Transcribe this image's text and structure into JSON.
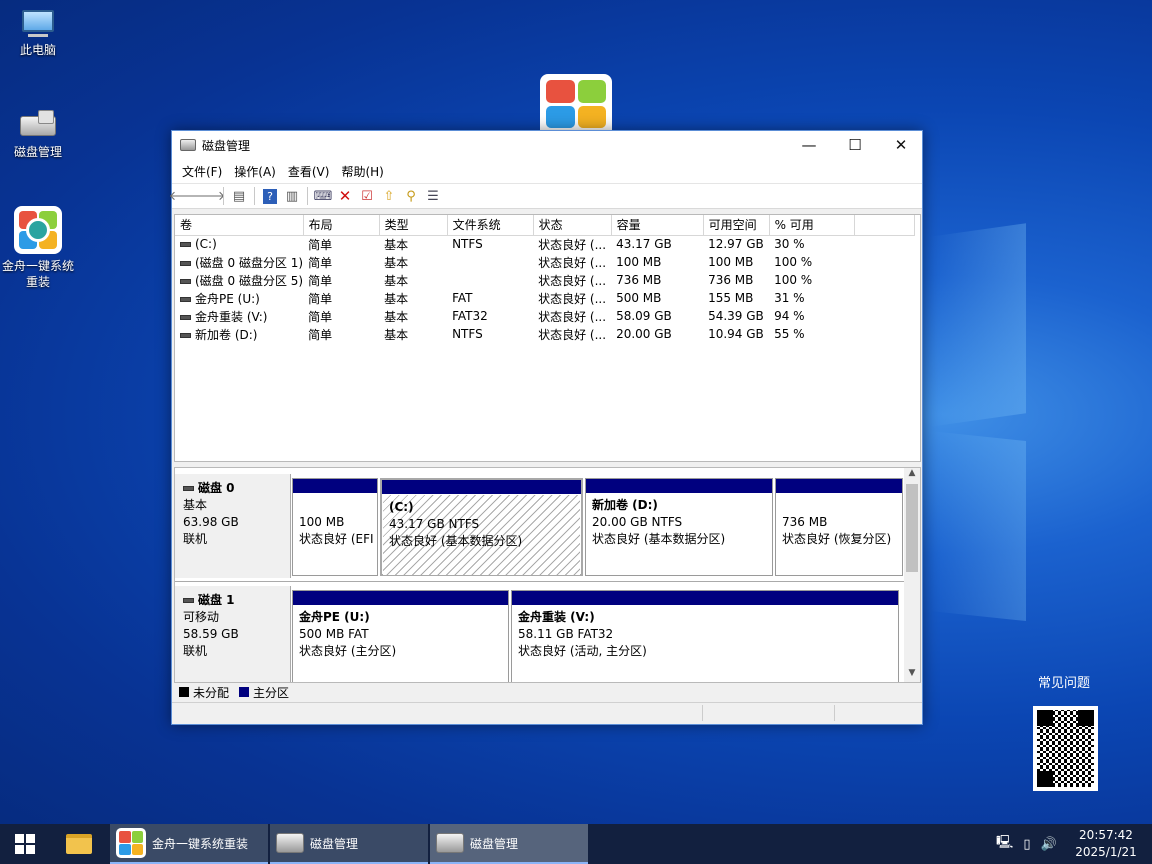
{
  "desktop": {
    "icons": [
      {
        "label": "此电脑",
        "icon": "computer-icon"
      },
      {
        "label": "磁盘管理",
        "icon": "disk-management-icon"
      },
      {
        "label": "金舟一键系统重装",
        "icon": "jinzhou-reinstall-icon"
      }
    ],
    "faq_label": "常见问题"
  },
  "window": {
    "title": "磁盘管理",
    "controls": {
      "minimize": "—",
      "maximize": "☐",
      "close": "✕"
    },
    "menu": [
      "文件(F)",
      "操作(A)",
      "查看(V)",
      "帮助(H)"
    ],
    "columns": [
      "卷",
      "布局",
      "类型",
      "文件系统",
      "状态",
      "容量",
      "可用空间",
      "% 可用"
    ],
    "volumes": [
      {
        "name": "(C:)",
        "layout": "简单",
        "type": "基本",
        "fs": "NTFS",
        "status": "状态良好 (...",
        "capacity": "43.17 GB",
        "free": "12.97 GB",
        "pct": "30 %"
      },
      {
        "name": "(磁盘 0 磁盘分区 1)",
        "layout": "简单",
        "type": "基本",
        "fs": "",
        "status": "状态良好 (...",
        "capacity": "100 MB",
        "free": "100 MB",
        "pct": "100 %"
      },
      {
        "name": "(磁盘 0 磁盘分区 5)",
        "layout": "简单",
        "type": "基本",
        "fs": "",
        "status": "状态良好 (...",
        "capacity": "736 MB",
        "free": "736 MB",
        "pct": "100 %"
      },
      {
        "name": "金舟PE (U:)",
        "layout": "简单",
        "type": "基本",
        "fs": "FAT",
        "status": "状态良好 (...",
        "capacity": "500 MB",
        "free": "155 MB",
        "pct": "31 %"
      },
      {
        "name": "金舟重装 (V:)",
        "layout": "简单",
        "type": "基本",
        "fs": "FAT32",
        "status": "状态良好 (...",
        "capacity": "58.09 GB",
        "free": "54.39 GB",
        "pct": "94 %"
      },
      {
        "name": "新加卷 (D:)",
        "layout": "简单",
        "type": "基本",
        "fs": "NTFS",
        "status": "状态良好 (...",
        "capacity": "20.00 GB",
        "free": "10.94 GB",
        "pct": "55 %"
      }
    ],
    "disks": [
      {
        "name": "磁盘 0",
        "kind": "基本",
        "size": "63.98 GB",
        "state": "联机",
        "partitions": [
          {
            "title": "",
            "size": "100 MB",
            "status": "状态良好 (EFI"
          },
          {
            "title": "(C:)",
            "size": "43.17 GB NTFS",
            "status": "状态良好 (基本数据分区)"
          },
          {
            "title": "新加卷  (D:)",
            "size": "20.00 GB NTFS",
            "status": "状态良好 (基本数据分区)"
          },
          {
            "title": "",
            "size": "736 MB",
            "status": "状态良好 (恢复分区)"
          }
        ]
      },
      {
        "name": "磁盘 1",
        "kind": "可移动",
        "size": "58.59 GB",
        "state": "联机",
        "partitions": [
          {
            "title": "金舟PE  (U:)",
            "size": "500 MB FAT",
            "status": "状态良好 (主分区)"
          },
          {
            "title": "金舟重装  (V:)",
            "size": "58.11 GB FAT32",
            "status": "状态良好 (活动, 主分区)"
          }
        ]
      }
    ],
    "legend": [
      {
        "label": "未分配",
        "color": "#000000"
      },
      {
        "label": "主分区",
        "color": "#00007f"
      }
    ]
  },
  "taskbar": {
    "apps": [
      {
        "label": "金舟一键系统重装"
      },
      {
        "label": "磁盘管理"
      },
      {
        "label": "磁盘管理"
      }
    ],
    "time": "20:57:42",
    "date": "2025/1/21"
  },
  "colors": {
    "partition_bar": "#00007f",
    "accent": "#0078d7"
  }
}
